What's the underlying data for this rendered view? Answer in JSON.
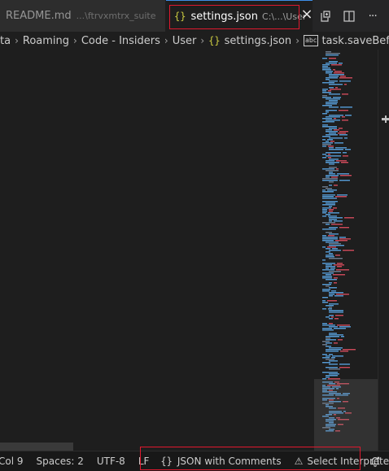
{
  "tabs": [
    {
      "title": "README.md",
      "description": "...\\ftrvxmtrx_suite"
    },
    {
      "icon": "{}",
      "title": "settings.json",
      "description": "C:\\...\\User"
    }
  ],
  "tab_close_glyph": "×",
  "tab_actions": [
    "open-changes-icon",
    "split-editor-icon",
    "more-actions-icon"
  ],
  "tab_more_glyph": "···",
  "breadcrumb": {
    "items": [
      "ta",
      "Roaming",
      "Code - Insiders",
      "User"
    ],
    "file_icon": "{}",
    "file": "settings.json",
    "symbol_icon": "abc",
    "symbol": "task.saveBeforeRun",
    "separator": "›"
  },
  "statusbar": {
    "position": "Col 9",
    "spaces": "Spaces: 2",
    "encoding": "UTF-8",
    "eol": "LF",
    "language_glyph": "{}",
    "language": "JSON with Comments",
    "warning_glyph": "⚠",
    "interpreter": "Select Interpreter"
  },
  "colors": {
    "accent": "#3c8ee8",
    "highlight": "#e0182e",
    "json_icon": "#cbcb41",
    "minimap_key": "#569cd6",
    "minimap_string": "#ce4a5a",
    "minimap_comment": "#6b7a8c"
  }
}
